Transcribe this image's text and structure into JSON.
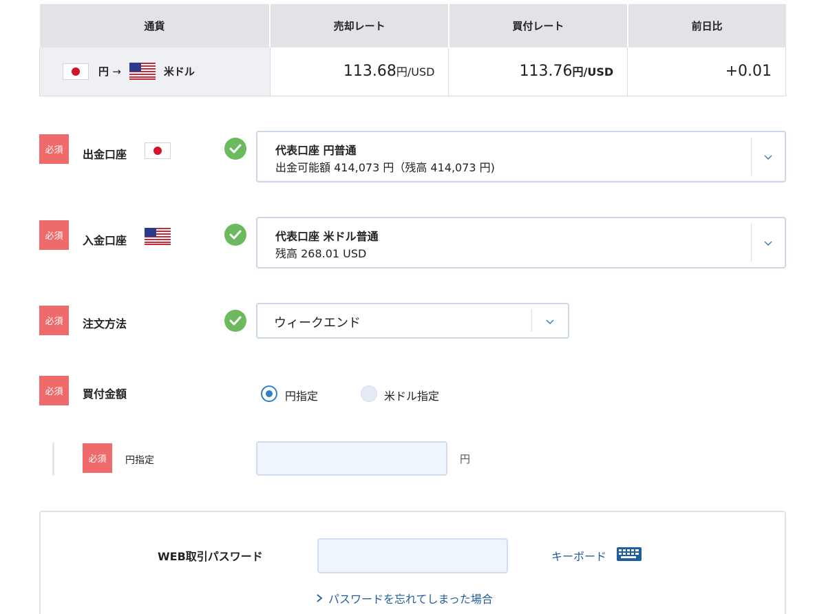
{
  "rate_table": {
    "headers": [
      "通貨",
      "売却レート",
      "買付レート",
      "前日比"
    ],
    "from_currency": "円",
    "arrow": "→",
    "to_currency": "米ドル",
    "sell_rate": "113.68",
    "sell_unit": "円/USD",
    "buy_rate": "113.76",
    "buy_unit": "円/USD",
    "change": "+0.01"
  },
  "required_label": "必須",
  "withdraw": {
    "label": "出金口座",
    "account_title": "代表口座 円普通",
    "account_detail": "出金可能額 414,073 円（残高 414,073 円)"
  },
  "deposit": {
    "label": "入金口座",
    "account_title": "代表口座 米ドル普通",
    "account_detail": "残高 268.01 USD"
  },
  "order_method": {
    "label": "注文方法",
    "selected": "ウィークエンド"
  },
  "buy_amount": {
    "label": "買付金額",
    "options": [
      "円指定",
      "米ドル指定"
    ],
    "selected_index": 0
  },
  "yen_amount": {
    "label": "円指定",
    "value": "",
    "unit": "円"
  },
  "password": {
    "label": "WEB取引パスワード",
    "value": "",
    "keyboard_label": "キーボード",
    "forgot_link": "パスワードを忘れてしまった場合"
  },
  "colors": {
    "required_badge": "#ef6a6a",
    "check_green": "#6cba5d",
    "link_blue": "#1f5e9c",
    "radio_blue": "#2f7fc4"
  }
}
